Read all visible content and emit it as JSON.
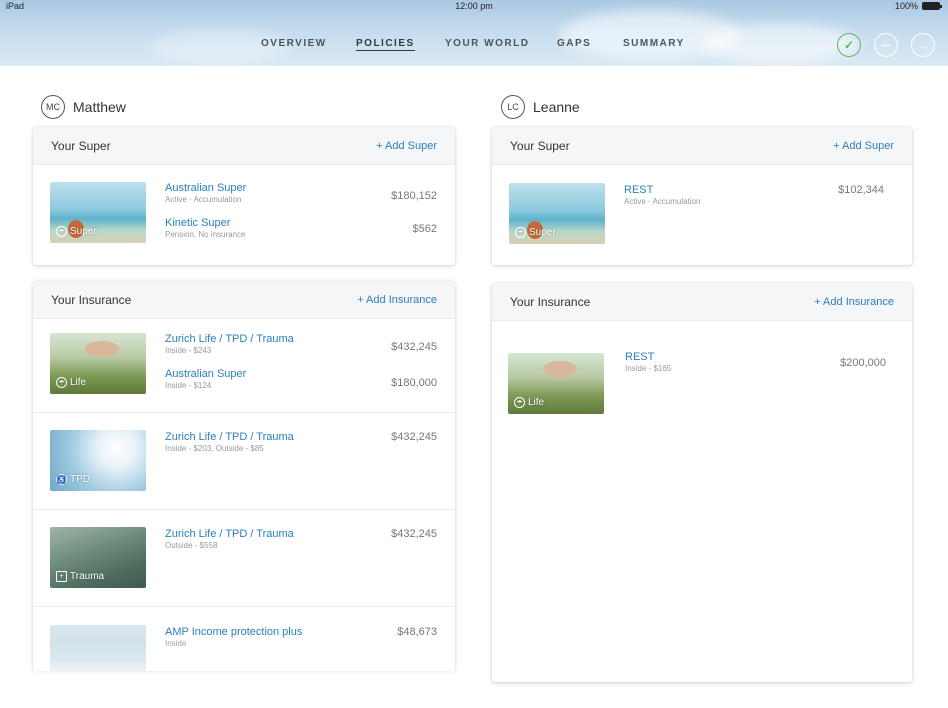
{
  "status_bar": {
    "device": "iPad",
    "time": "12:00 pm",
    "battery": "100%"
  },
  "nav": {
    "tabs": [
      {
        "label": "OVERVIEW",
        "active": false
      },
      {
        "label": "POLICIES",
        "active": true
      },
      {
        "label": "YOUR WORLD",
        "active": false
      },
      {
        "label": "GAPS",
        "active": false
      },
      {
        "label": "SUMMARY",
        "active": false
      }
    ],
    "buttons": {
      "check": "✓",
      "more": "•••",
      "next": "→"
    }
  },
  "matthew": {
    "initials": "MC",
    "name": "Matthew",
    "super": {
      "title": "Your Super",
      "action": "+ Add Super",
      "image_label": "Super",
      "entries": [
        {
          "name": "Australian Super",
          "sub": "Active - Accumulation",
          "amount": "$180,152"
        },
        {
          "name": "Kinetic Super",
          "sub": "Pension, No insurance",
          "amount": "$562"
        }
      ]
    },
    "insurance": {
      "title": "Your Insurance",
      "action": "+ Add Insurance",
      "rows": [
        {
          "image_label": "Life",
          "entries": [
            {
              "name": "Zurich Life / TPD / Trauma",
              "sub": "Inside - $243",
              "amount": "$432,245"
            },
            {
              "name": "Australian Super",
              "sub": "Inside - $124",
              "amount": "$180,000"
            }
          ]
        },
        {
          "image_label": "TPD",
          "entries": [
            {
              "name": "Zurich Life / TPD / Trauma",
              "sub": "Inside - $203, Outside - $85",
              "amount": "$432,245"
            }
          ]
        },
        {
          "image_label": "Trauma",
          "entries": [
            {
              "name": "Zurich Life / TPD / Trauma",
              "sub": "Outside - $558",
              "amount": "$432,245"
            }
          ]
        },
        {
          "image_label": "",
          "entries": [
            {
              "name": "AMP Income protection plus",
              "sub": "Inside",
              "amount": "$48,673"
            }
          ]
        }
      ]
    }
  },
  "leanne": {
    "initials": "LC",
    "name": "Leanne",
    "super": {
      "title": "Your Super",
      "action": "+ Add Super",
      "image_label": "Super",
      "entries": [
        {
          "name": "REST",
          "sub": "Active - Accumulation",
          "amount": "$102,344"
        }
      ]
    },
    "insurance": {
      "title": "Your Insurance",
      "action": "+ Add Insurance",
      "rows": [
        {
          "image_label": "Life",
          "entries": [
            {
              "name": "REST",
              "sub": "Inside - $165",
              "amount": "$200,000"
            }
          ]
        }
      ]
    }
  }
}
